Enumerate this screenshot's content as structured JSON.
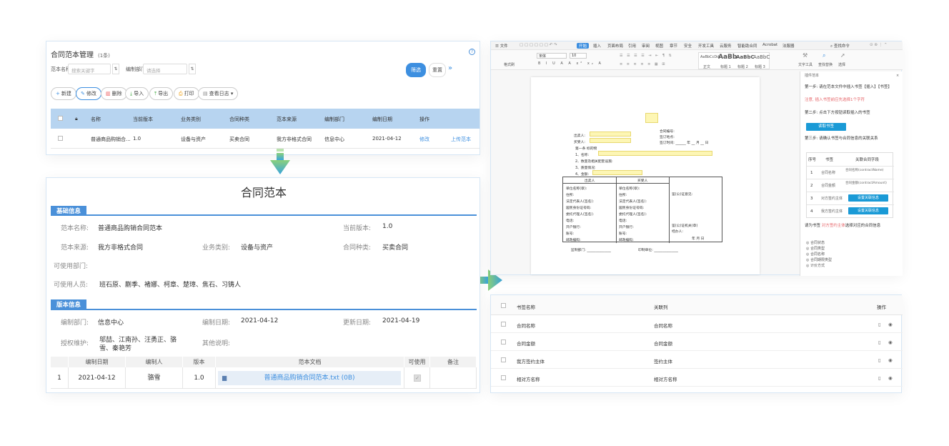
{
  "list_panel": {
    "title": "合同范本管理",
    "count": "(1条)",
    "help_icon": "question-icon",
    "filters": [
      {
        "label": "范本名称",
        "placeholder": "搜索关键字"
      },
      {
        "label": "编制部门",
        "placeholder": "请选择"
      }
    ],
    "filter_button": "筛选",
    "reset_button": "重置",
    "expand_icon": "»",
    "toolbar": [
      "新建",
      "修改",
      "删除",
      "导入",
      "导出",
      "打印",
      "查看日志"
    ],
    "columns": [
      "名称",
      "当前版本",
      "业务类别",
      "合同种类",
      "范本来源",
      "编制部门",
      "编制日期",
      "操作"
    ],
    "rows": [
      {
        "name": "普通商品购销合...",
        "version": "1.0",
        "category": "设备与资产",
        "kind": "买卖合同",
        "source": "我方非格式合同",
        "dept": "信息中心",
        "date": "2021-04-12",
        "edit": "修改",
        "upload": "上传范本"
      }
    ]
  },
  "detail_panel": {
    "title": "合同范本",
    "basic_section": "基础信息",
    "basic": {
      "name_label": "范本名称:",
      "name_value": "普通商品购销合同范本",
      "version_label": "当前版本:",
      "version_value": "1.0",
      "source_label": "范本来源:",
      "source_value": "我方非格式合同",
      "category_label": "业务类别:",
      "category_value": "设备与资产",
      "kind_label": "合同种类:",
      "kind_value": "买卖合同",
      "dept_label": "可使用部门:",
      "users_label": "可使用人员:",
      "users_value": "班石原、蒯季、褚娜、柯章、楚璋、焦石、习铸人"
    },
    "version_section": "版本信息",
    "version": {
      "dept_label": "编制部门:",
      "dept_value": "信息中心",
      "date_label": "编制日期:",
      "date_value": "2021-04-12",
      "update_label": "更新日期:",
      "update_value": "2021-04-19",
      "auth_label": "授权维护:",
      "auth_value_1": "邬喆、江南孙、汪勇正、骆",
      "auth_value_2": "雪、秦艳芳",
      "other_label": "其他说明:"
    },
    "table_columns": [
      "编制日期",
      "编制人",
      "版本",
      "范本文档",
      "可使用",
      "备注"
    ],
    "table_rows": [
      {
        "no": "1",
        "date": "2021-04-12",
        "author": "骆雪",
        "version": "1.0",
        "doc": "普通商品购销合同范本.txt (0B)"
      }
    ]
  },
  "editor_panel": {
    "menu": [
      "文件",
      "开始",
      "插入",
      "页面布局",
      "引用",
      "审阅",
      "视图",
      "章节",
      "安全",
      "开发工具",
      "云服务",
      "智能助合同",
      "Acrobat",
      "法服器"
    ],
    "active_menu": "开始",
    "search": "查找命令",
    "font_name": "宋体",
    "font_size": "10",
    "styles": [
      "正文",
      "标题 1",
      "标题 2",
      "标题 3"
    ],
    "style_samples": [
      "AaBbCcDd",
      "AaBb",
      "AaBbC",
      "AaBbC"
    ],
    "tools": [
      "文字工具",
      "查找替换",
      "选择"
    ],
    "format_painter": "格式刷",
    "doc": {
      "contract_no": "合同编号:",
      "sign_place": "签订地点:",
      "sign_time": "签订时间:",
      "year": "年",
      "month": "月",
      "day": "日",
      "seller": "出卖人:",
      "buyer": "买受人:",
      "item": "第一条  标的物",
      "line1": "1、名称:",
      "line2": "2、数量及相关配套设施:",
      "line3": "3、质量情况:",
      "line4": "4、金额:",
      "col_seller": "出卖人",
      "col_buyer": "买受人",
      "fields": [
        "单位名称(章):",
        "住所:",
        "法定代表人(签名):",
        "居民身份证号码:",
        "委托代理人(签名):",
        "电话:",
        "开户银行:",
        "账号:",
        "邮政编码:"
      ],
      "fields_right": [
        "单位名称(章):",
        "住所:",
        "法定代表人(签名):",
        "居民身份证号码:",
        "委托代理人(签名):",
        "电话:",
        "开户银行:",
        "账号:",
        "邮政编码:"
      ],
      "audit_1": "鉴(公)证意见:",
      "audit_2": "鉴(公)证机关(章)",
      "audit_3": "经办人:",
      "audit_4": "年  月  日",
      "footer_1": "监制部门:",
      "footer_2": "印制单位:"
    },
    "side": {
      "title": "插件范本",
      "step1": "第一步: 请在范本文件中插入书签【插入】【书签】",
      "warn": "注意, 插入书签前应先选择1个字符",
      "step2": "第二步: 点击下方按钮读取插入的书签",
      "read_btn": "读取书签",
      "step3": "第三步: 请确认书签与合同信息的关联关系",
      "cols": [
        "序号",
        "书签",
        "关联合同字段"
      ],
      "rows": [
        {
          "no": "1",
          "tag": "合同名称",
          "field": "合同名称(contractName)"
        },
        {
          "no": "2",
          "tag": "合同金额",
          "field": "合同金额(contractAmount)"
        },
        {
          "no": "3",
          "tag": "对方签约主体",
          "field": "设置关联信息"
        },
        {
          "no": "4",
          "tag": "我方签约主体",
          "field": "设置关联信息"
        }
      ],
      "hint_1": "请为书签",
      "hint_red": "对方签约主体",
      "hint_2": "选择对应的合同信息",
      "options": [
        "合同状态",
        "合同类型",
        "合同名称",
        "合同期限类型",
        "计价方式"
      ]
    }
  },
  "bookmark_panel": {
    "columns": [
      "书签名称",
      "关联列",
      "操作"
    ],
    "rows": [
      {
        "name": "合同名称",
        "col": "合同名称"
      },
      {
        "name": "合同金额",
        "col": "合同金额"
      },
      {
        "name": "我方签约主体",
        "col": "签约主体"
      },
      {
        "name": "相对方名称",
        "col": "相对方名称"
      }
    ]
  },
  "colors": {
    "accent": "#3d8fe0",
    "section": "#4a90d9",
    "header_bg": "#b7d4f0",
    "arrow": "#3cb9d6",
    "highlight": "#fdf6b4"
  }
}
